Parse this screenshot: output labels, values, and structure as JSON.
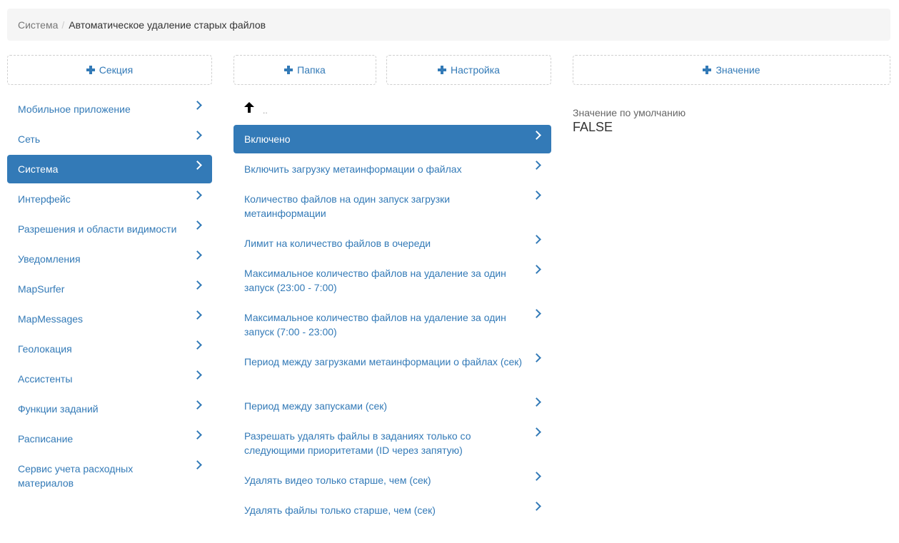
{
  "breadcrumb": {
    "parent": "Система",
    "separator": "/",
    "current": "Автоматическое удаление старых файлов"
  },
  "buttons": {
    "section": "Секция",
    "folder": "Папка",
    "setting": "Настройка",
    "value": "Значение",
    "icon": "plus-icon"
  },
  "sections": [
    {
      "label": "Мобильное приложение"
    },
    {
      "label": "Сеть"
    },
    {
      "label": "Система",
      "active": true
    },
    {
      "label": "Интерфейс"
    },
    {
      "label": "Разрешения и области видимости"
    },
    {
      "label": "Уведомления"
    },
    {
      "label": "MapSurfer"
    },
    {
      "label": "MapMessages"
    },
    {
      "label": "Геолокация"
    },
    {
      "label": "Ассистенты"
    },
    {
      "label": "Функции заданий"
    },
    {
      "label": "Расписание"
    },
    {
      "label": "Сервис учета расходных материалов"
    }
  ],
  "navigation": {
    "up_icon": "arrow-up-icon",
    "up_label": ".."
  },
  "settings": [
    {
      "label": "Включено",
      "active": true
    },
    {
      "label": "Включить загрузку метаинформации о файлах"
    },
    {
      "label": "Количество файлов на один запуск загрузки метаинформации"
    },
    {
      "label": "Лимит на количество файлов в очереди"
    },
    {
      "label": "Максимальное количество файлов на удаление за один запуск (23:00 - 7:00)"
    },
    {
      "label": "Максимальное количество файлов на удаление за один запуск (7:00 - 23:00)"
    },
    {
      "label": "Период между загрузками метаинформации о файлах (сек)"
    },
    {
      "label": "Период между запусками (сек)"
    },
    {
      "label": "Разрешать удалять файлы в заданиях только со следующими приоритетами (ID через запятую)"
    },
    {
      "label": "Удалять видео только старше, чем (сек)"
    },
    {
      "label": "Удалять файлы только старше, чем (сек)"
    }
  ],
  "value_panel": {
    "label": "Значение по умолчанию",
    "value": "FALSE"
  },
  "colors": {
    "accent": "#337ab7",
    "breadcrumb_bg": "#f5f5f5",
    "dashed_border": "#cfcfcf"
  }
}
